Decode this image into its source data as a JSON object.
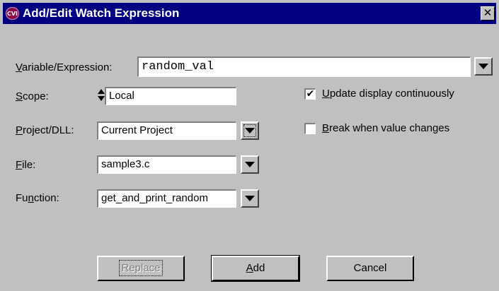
{
  "window": {
    "title": "Add/Edit Watch Expression",
    "app_icon": "cvi-icon",
    "close_glyph": "✕"
  },
  "fields": {
    "expression": {
      "label_mn": "V",
      "label_rest": "ariable/Expression:",
      "value": "random_val"
    },
    "scope": {
      "label_mn": "S",
      "label_rest": "cope:",
      "value": "Local"
    },
    "project": {
      "label_pre": "",
      "label_mn": "P",
      "label_rest": "roject/DLL:",
      "value": "Current Project"
    },
    "file": {
      "label_mn": "F",
      "label_rest": "ile:",
      "value": "sample3.c"
    },
    "function": {
      "label_pre": "Fu",
      "label_mn": "n",
      "label_rest": "ction:",
      "value": "get_and_print_random"
    }
  },
  "options": {
    "update_continuously": {
      "label_mn": "U",
      "label_rest": "pdate display continuously",
      "checked": true,
      "mark": "✔"
    },
    "break_on_change": {
      "label_mn": "B",
      "label_rest": "reak when value changes",
      "checked": false,
      "mark": ""
    }
  },
  "buttons": {
    "replace": "Replace",
    "add_mn": "A",
    "add_rest": "dd",
    "cancel": "Cancel"
  }
}
